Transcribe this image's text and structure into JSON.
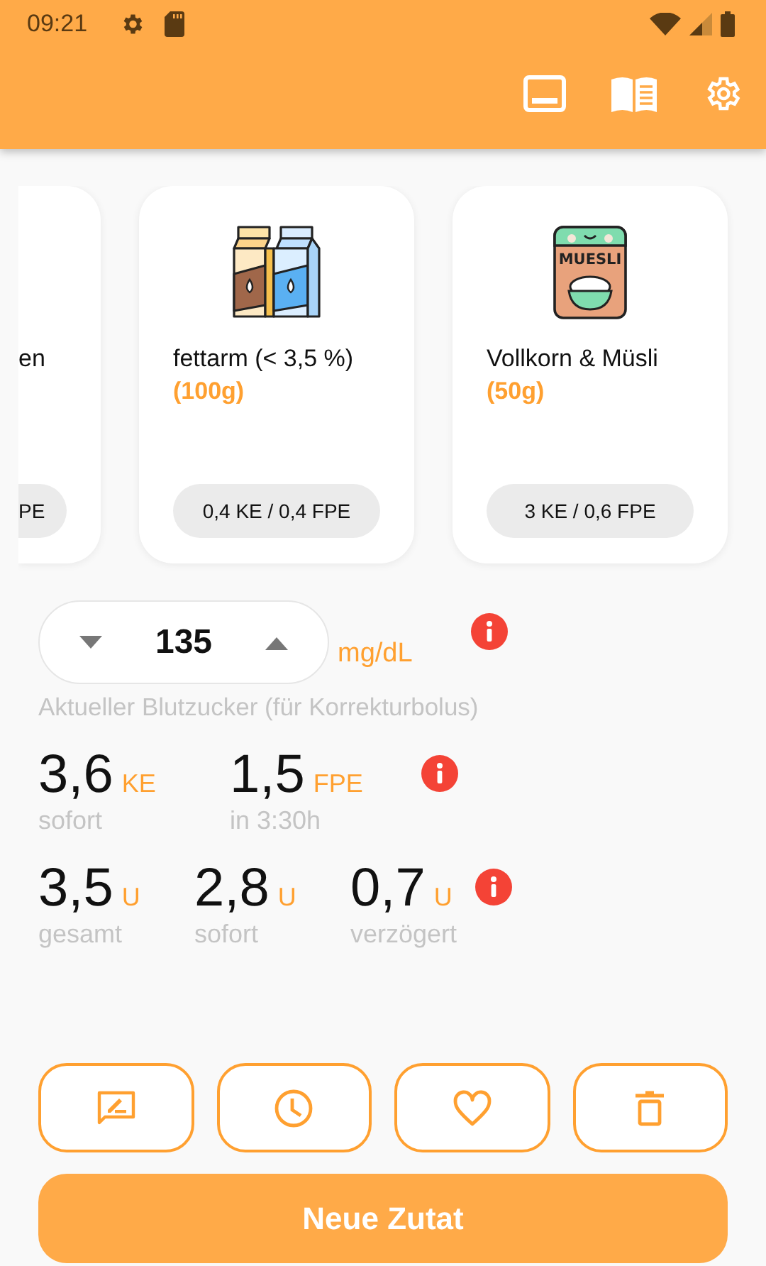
{
  "status_bar": {
    "time": "09:21"
  },
  "cards": [
    {
      "kind": "partial",
      "name": "en",
      "values": "PE"
    },
    {
      "kind": "milk",
      "name": "fettarm (< 3,5 %)",
      "amount": "(100g)",
      "values": "0,4 KE / 0,4 FPE"
    },
    {
      "kind": "cereal",
      "name": "Vollkorn & Müsli",
      "amount": "(50g)",
      "values": "3 KE / 0,6 FPE",
      "pack_label": "MUESLI"
    }
  ],
  "glucose": {
    "value": "135",
    "unit": "mg/dL",
    "caption": "Aktueller Blutzucker (für Korrekturbolus)"
  },
  "carb_row": [
    {
      "value": "3,6",
      "unit": "KE",
      "label": "sofort"
    },
    {
      "value": "1,5",
      "unit": "FPE",
      "label": "in 3:30h"
    }
  ],
  "insulin_row": [
    {
      "value": "3,5",
      "unit": "U",
      "label": "gesamt"
    },
    {
      "value": "2,8",
      "unit": "U",
      "label": "sofort"
    },
    {
      "value": "0,7",
      "unit": "U",
      "label": "verzögert"
    }
  ],
  "primary_button": "Neue Zutat"
}
